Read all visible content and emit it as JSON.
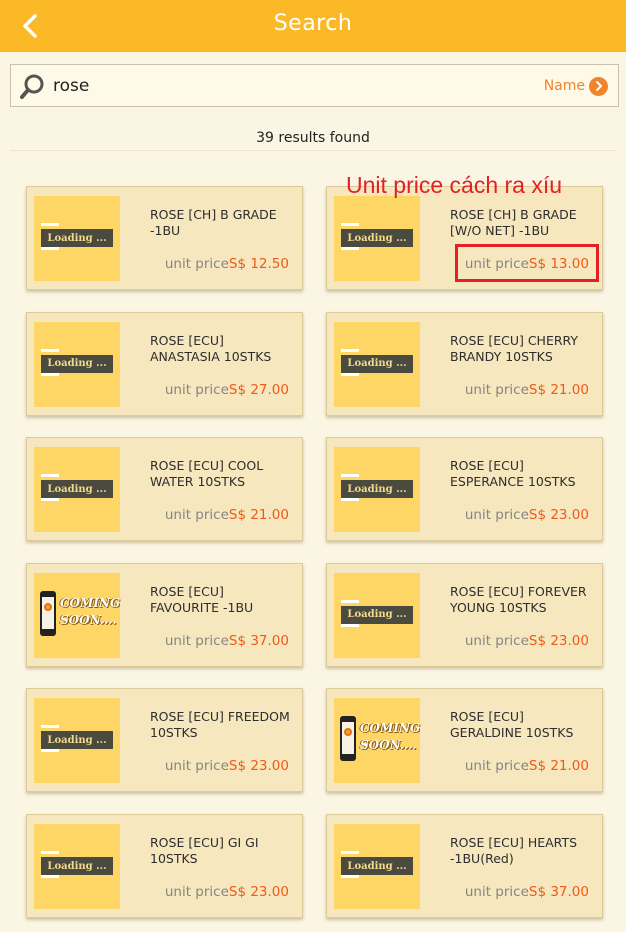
{
  "header": {
    "title": "Search",
    "back_icon": "chevron-left-icon"
  },
  "search": {
    "value": "rose",
    "placeholder": "",
    "icon": "search-icon"
  },
  "sort": {
    "label": "Name",
    "icon": "circle-arrow-right-icon"
  },
  "results": {
    "count_text": "39 results found"
  },
  "annotation": {
    "text": "Unit price cách ra xíu"
  },
  "loading_text": "Loading ...",
  "coming_soon_text": "COMING SOON....",
  "price_label": "unit price",
  "colors": {
    "accent": "#fbb928",
    "price": "#f05a19",
    "annotation": "#e32025",
    "card": "#f6e7be"
  },
  "products": [
    {
      "name": "ROSE [CH] B GRADE -1BU",
      "price": "S$ 12.50",
      "image": "loading"
    },
    {
      "name": "ROSE [CH] B GRADE [W/O NET]  -1BU",
      "price": "S$ 13.00",
      "image": "loading",
      "highlighted": true
    },
    {
      "name": "ROSE [ECU] ANASTASIA 10STKS",
      "price": "S$ 27.00",
      "image": "loading"
    },
    {
      "name": "ROSE [ECU] CHERRY BRANDY 10STKS",
      "price": "S$ 21.00",
      "image": "loading"
    },
    {
      "name": "ROSE [ECU] COOL WATER 10STKS",
      "price": "S$ 21.00",
      "image": "loading"
    },
    {
      "name": "ROSE [ECU] ESPERANCE 10STKS",
      "price": "S$ 23.00",
      "image": "loading"
    },
    {
      "name": "ROSE [ECU] FAVOURITE  -1BU",
      "price": "S$ 37.00",
      "image": "coming-soon"
    },
    {
      "name": "ROSE [ECU] FOREVER YOUNG 10STKS",
      "price": "S$ 23.00",
      "image": "loading"
    },
    {
      "name": "ROSE [ECU] FREEDOM 10STKS",
      "price": "S$ 23.00",
      "image": "loading"
    },
    {
      "name": "ROSE [ECU] GERALDINE 10STKS",
      "price": "S$ 21.00",
      "image": "coming-soon"
    },
    {
      "name": "ROSE [ECU] GI GI 10STKS",
      "price": "S$ 23.00",
      "image": "loading"
    },
    {
      "name": "ROSE [ECU] HEARTS -1BU(Red)",
      "price": "S$ 37.00",
      "image": "loading"
    }
  ]
}
